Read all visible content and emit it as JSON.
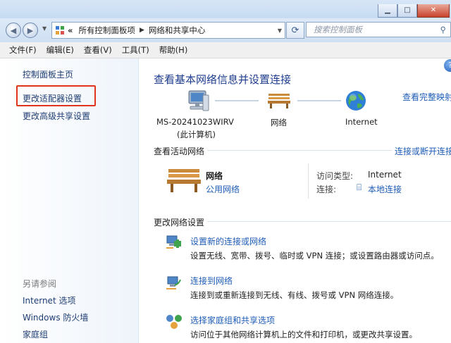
{
  "address": {
    "overflow": "«",
    "segments": [
      "所有控制面板项",
      "网络和共享中心"
    ]
  },
  "search": {
    "placeholder": "搜索控制面板"
  },
  "menu": [
    "文件(F)",
    "编辑(E)",
    "查看(V)",
    "工具(T)",
    "帮助(H)"
  ],
  "sidebar": {
    "home": "控制面板主页",
    "adapter": "更改适配器设置",
    "advanced": "更改高级共享设置",
    "see_also": "另请参阅",
    "internet_options": "Internet 选项",
    "firewall": "Windows 防火墙",
    "homegroup": "家庭组"
  },
  "main": {
    "title": "查看基本网络信息并设置连接",
    "full_map": "查看完整映射",
    "map": {
      "computer_name": "MS-20241023WIRV",
      "computer_sub": "(此计算机)",
      "network": "网络",
      "internet": "Internet"
    },
    "active": {
      "header": "查看活动网络",
      "connect_link": "连接或断开连接",
      "network_name": "网络",
      "network_type": "公用网络",
      "access_label": "访问类型:",
      "access_value": "Internet",
      "conn_label": "连接:",
      "conn_value": "本地连接"
    },
    "change": {
      "header": "更改网络设置",
      "items": [
        {
          "title": "设置新的连接或网络",
          "desc": "设置无线、宽带、拨号、临时或 VPN 连接；或设置路由器或访问点。"
        },
        {
          "title": "连接到网络",
          "desc": "连接到或重新连接到无线、有线、拨号或 VPN 网络连接。"
        },
        {
          "title": "选择家庭组和共享选项",
          "desc": "访问位于其他网络计算机上的文件和打印机，或更改共享设置。"
        }
      ]
    }
  },
  "colors": {
    "link": "#1f5db7",
    "title": "#1e3d8f",
    "highlight": "#e0341f"
  }
}
